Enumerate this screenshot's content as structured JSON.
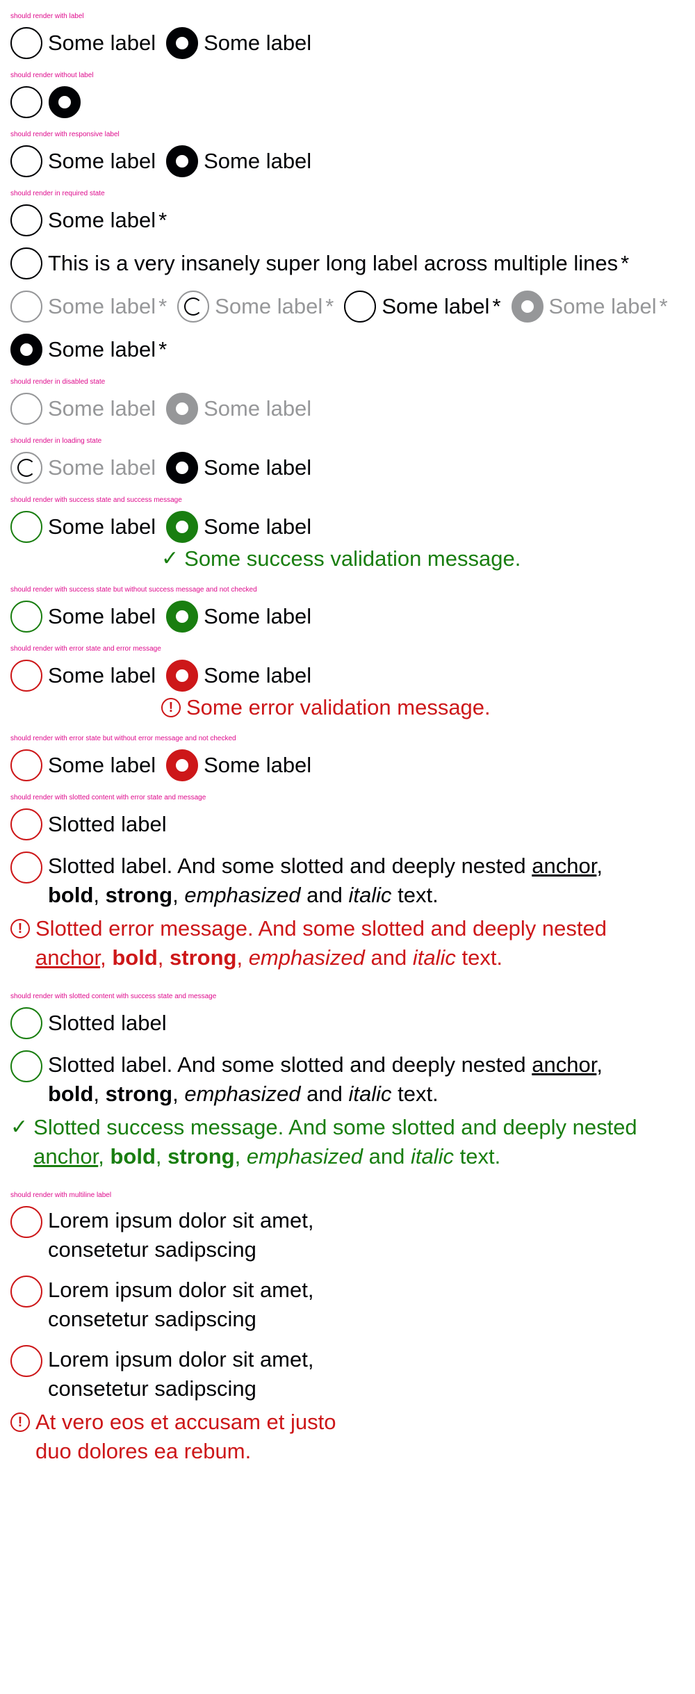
{
  "sections": {
    "s1": "should render with label",
    "s2": "should render without label",
    "s3": "should render with responsive label",
    "s4": "should render in required state",
    "s5": "should render in disabled state",
    "s6": "should render in loading state",
    "s7": "should render with success state and success message",
    "s8": "should render with success state but without success message and not checked",
    "s9": "should render with error state and error message",
    "s10": "should render with error state but without error message and not checked",
    "s11": "should render with slotted content with error state and message",
    "s12": "should render with slotted content with success state and message",
    "s13": "should render with multiline label"
  },
  "labels": {
    "some": "Some label",
    "required_mark": "*",
    "long": "This is a very insanely super long label across multiple lines",
    "slotted": "Slotted label",
    "slotted_long_pre": "Slotted label. And some slotted and deeply nested",
    "anchor": "anchor",
    "bold": "bold",
    "strong": "strong",
    "emphasized": "emphasized",
    "and": "and",
    "italic": "italic",
    "text": "text.",
    "comma": ",",
    "lorem": "Lorem ipsum dolor sit amet, consetetur sadipscing"
  },
  "messages": {
    "success": "Some success validation message.",
    "error": "Some error validation message.",
    "slotted_error_pre": "Slotted error message. And some slotted and deeply nested",
    "slotted_success_pre": "Slotted success message. And some slotted and deeply nested",
    "multiline_error": "At vero eos et accusam et justo duo dolores ea rebum."
  },
  "icons": {
    "success": "checkmark-icon",
    "error": "exclamation-circle-icon"
  },
  "colors": {
    "section_title": "#de0a8c",
    "primary": "#010205",
    "disabled": "#969799",
    "success": "#197e10",
    "error": "#cd1719"
  }
}
